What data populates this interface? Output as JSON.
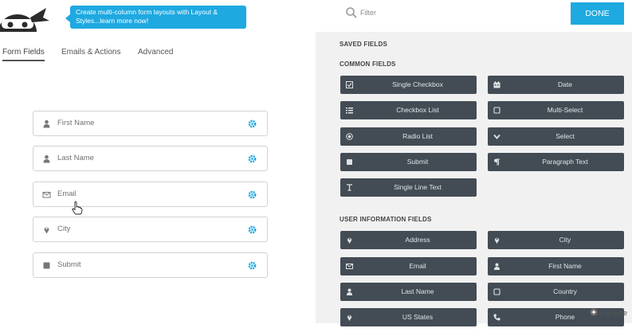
{
  "header": {
    "tip_text": "Create multi-column form layouts with Layout & Styles...learn more now!",
    "filter_placeholder": "Filter",
    "done_label": "DONE"
  },
  "tabs": [
    {
      "label": "Form Fields",
      "active": true
    },
    {
      "label": "Emails & Actions",
      "active": false
    },
    {
      "label": "Advanced",
      "active": false
    }
  ],
  "form_fields": [
    {
      "label": "First Name",
      "icon": "user-icon"
    },
    {
      "label": "Last Name",
      "icon": "user-icon"
    },
    {
      "label": "Email",
      "icon": "envelope-icon"
    },
    {
      "label": "City",
      "icon": "map-pin-icon"
    },
    {
      "label": "Submit",
      "icon": "square-icon"
    }
  ],
  "panel": {
    "saved_fields_title": "SAVED FIELDS",
    "common_fields_title": "COMMON FIELDS",
    "user_info_title": "USER INFORMATION FIELDS",
    "common_fields": [
      {
        "label": "Single Checkbox",
        "icon": "checkbox-icon"
      },
      {
        "label": "Date",
        "icon": "calendar-icon"
      },
      {
        "label": "Checkbox List",
        "icon": "list-icon"
      },
      {
        "label": "Multi-Select",
        "icon": "square-outline-icon"
      },
      {
        "label": "Radio List",
        "icon": "radio-icon"
      },
      {
        "label": "Select",
        "icon": "chevron-down-icon"
      },
      {
        "label": "Submit",
        "icon": "square-icon"
      },
      {
        "label": "Paragraph Text",
        "icon": "paragraph-icon"
      },
      {
        "label": "Single Line Text",
        "icon": "text-cursor-icon"
      }
    ],
    "user_info_fields": [
      {
        "label": "Address",
        "icon": "map-pin-icon"
      },
      {
        "label": "City",
        "icon": "map-pin-icon"
      },
      {
        "label": "Email",
        "icon": "envelope-icon"
      },
      {
        "label": "First Name",
        "icon": "user-icon"
      },
      {
        "label": "Last Name",
        "icon": "user-icon"
      },
      {
        "label": "Country",
        "icon": "square-outline-icon"
      },
      {
        "label": "US States",
        "icon": "map-pin-icon"
      },
      {
        "label": "Phone",
        "icon": "phone-icon"
      }
    ],
    "fullscreen_label": "Full scre"
  },
  "colors": {
    "accent": "#1ea9e1",
    "field_button_bg": "#434c55",
    "panel_bg": "#f1f1f1"
  }
}
